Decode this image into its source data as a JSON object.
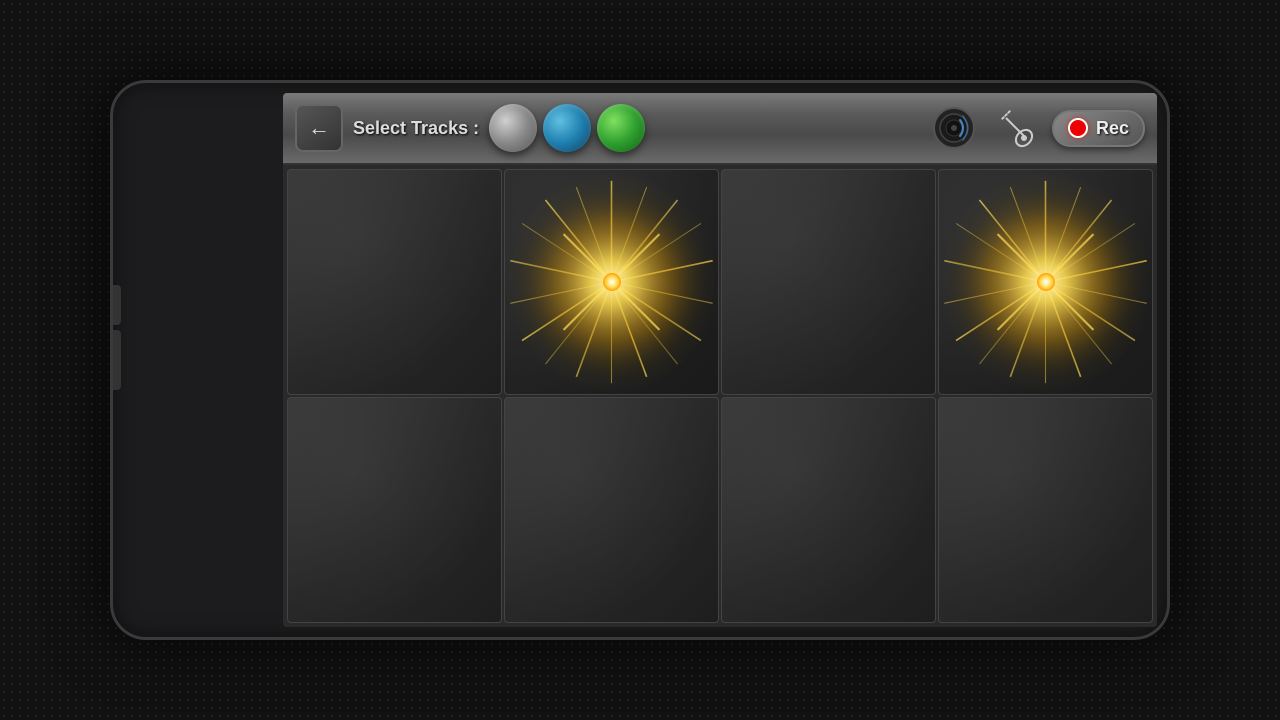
{
  "toolbar": {
    "back_label": "←",
    "select_tracks_label": "Select Tracks :",
    "rec_label": "Rec",
    "track_buttons": [
      {
        "id": "grey",
        "type": "grey",
        "label": "Grey track"
      },
      {
        "id": "blue",
        "type": "blue",
        "label": "Blue track"
      },
      {
        "id": "green",
        "type": "green",
        "label": "Green track"
      }
    ]
  },
  "grid": {
    "rows": 2,
    "cols": 4,
    "cells": [
      {
        "id": 0,
        "active": false,
        "row": 0,
        "col": 0
      },
      {
        "id": 1,
        "active": true,
        "row": 0,
        "col": 1
      },
      {
        "id": 2,
        "active": false,
        "row": 0,
        "col": 2
      },
      {
        "id": 3,
        "active": true,
        "row": 0,
        "col": 3
      },
      {
        "id": 4,
        "active": false,
        "row": 1,
        "col": 0
      },
      {
        "id": 5,
        "active": false,
        "row": 1,
        "col": 1
      },
      {
        "id": 6,
        "active": false,
        "row": 1,
        "col": 2
      },
      {
        "id": 7,
        "active": false,
        "row": 1,
        "col": 3
      }
    ]
  },
  "icons": {
    "back": "←",
    "rec_dot_color": "#cc0000",
    "speaker_color": "#4488cc",
    "guitar_color": "#cccccc"
  }
}
